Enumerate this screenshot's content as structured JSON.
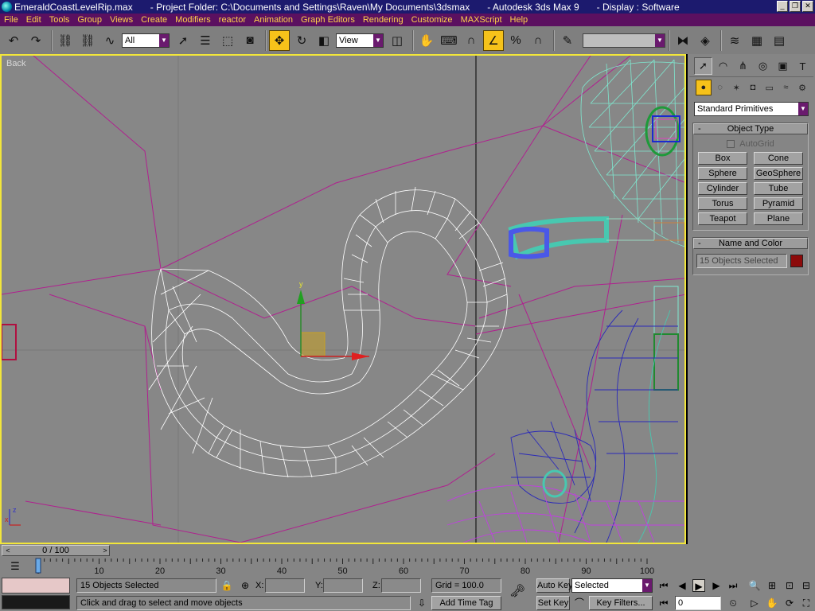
{
  "titlebar": {
    "file": "EmeraldCoastLevelRip.max",
    "project": "- Project Folder: C:\\Documents and Settings\\Raven\\My Documents\\3dsmax",
    "app": "- Autodesk 3ds Max 9",
    "display": "- Display : Software"
  },
  "menu": [
    "File",
    "Edit",
    "Tools",
    "Group",
    "Views",
    "Create",
    "Modifiers",
    "reactor",
    "Animation",
    "Graph Editors",
    "Rendering",
    "Customize",
    "MAXScript",
    "Help"
  ],
  "toolbar": {
    "selection_filter": "All",
    "reference_coord": "View",
    "named_selection": ""
  },
  "viewport": {
    "label": "Back"
  },
  "command_panel": {
    "category": "Standard Primitives",
    "object_type": {
      "title": "Object Type",
      "autogrid": "AutoGrid",
      "buttons": [
        "Box",
        "Cone",
        "Sphere",
        "GeoSphere",
        "Cylinder",
        "Tube",
        "Torus",
        "Pyramid",
        "Teapot",
        "Plane"
      ]
    },
    "name_and_color": {
      "title": "Name and Color",
      "name_value": "15 Objects Selected",
      "color": "#8c0a0a"
    }
  },
  "time_slider": {
    "label": "0 / 100",
    "current_frame": 0,
    "total_frames": 100
  },
  "trackbar": {
    "ticks": [
      "0",
      "10",
      "20",
      "30",
      "40",
      "50",
      "60",
      "70",
      "80",
      "90",
      "100"
    ]
  },
  "status": {
    "selection_count": "15 Objects Selected",
    "prompt": "Click and drag to select and move objects",
    "x_label": "X:",
    "y_label": "Y:",
    "z_label": "Z:",
    "x_value": "",
    "y_value": "",
    "z_value": "",
    "grid": "Grid = 100.0",
    "add_time_tag": "Add Time Tag",
    "auto_key": "Auto Key",
    "set_key": "Set Key",
    "key_mode": "Selected",
    "key_filters": "Key Filters...",
    "frame_value": "0"
  },
  "colors": {
    "viewport_bg": "#878787",
    "active_viewport_border": "#f2e63a",
    "menubar": "#5b1060",
    "menu_text": "#ffd24a",
    "wire_white": "#ffffff",
    "wire_magenta": "#b0208f",
    "wire_cyan": "#7fe8d0",
    "wire_blue": "#2b2ab8",
    "wire_violet": "#c040e0"
  }
}
